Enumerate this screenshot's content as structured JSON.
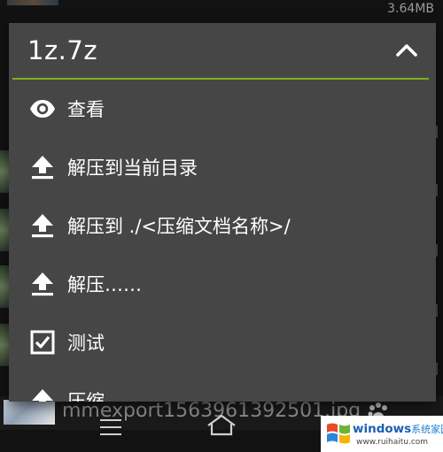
{
  "background": {
    "file_size": "3.64MB",
    "bottom_filename": "mmexport1563961392501.jpg"
  },
  "popup": {
    "title": "1z.7z",
    "accent_color": "#7fb11c",
    "items": [
      {
        "icon": "eye-icon",
        "label": "查看"
      },
      {
        "icon": "upload-icon",
        "label": "解压到当前目录"
      },
      {
        "icon": "upload-icon",
        "label": "解压到 ./<压缩文档名称>/"
      },
      {
        "icon": "upload-icon",
        "label": "解压……"
      },
      {
        "icon": "checkbox-icon",
        "label": "测试"
      },
      {
        "icon": "upload-icon",
        "label": "压缩"
      }
    ]
  },
  "navbar": {
    "buttons": [
      "menu-icon",
      "home-icon",
      "back-icon"
    ]
  },
  "watermark": {
    "brand": "windows",
    "brand_suffix": "系统家园",
    "url": "www.ruihaitu.com"
  }
}
